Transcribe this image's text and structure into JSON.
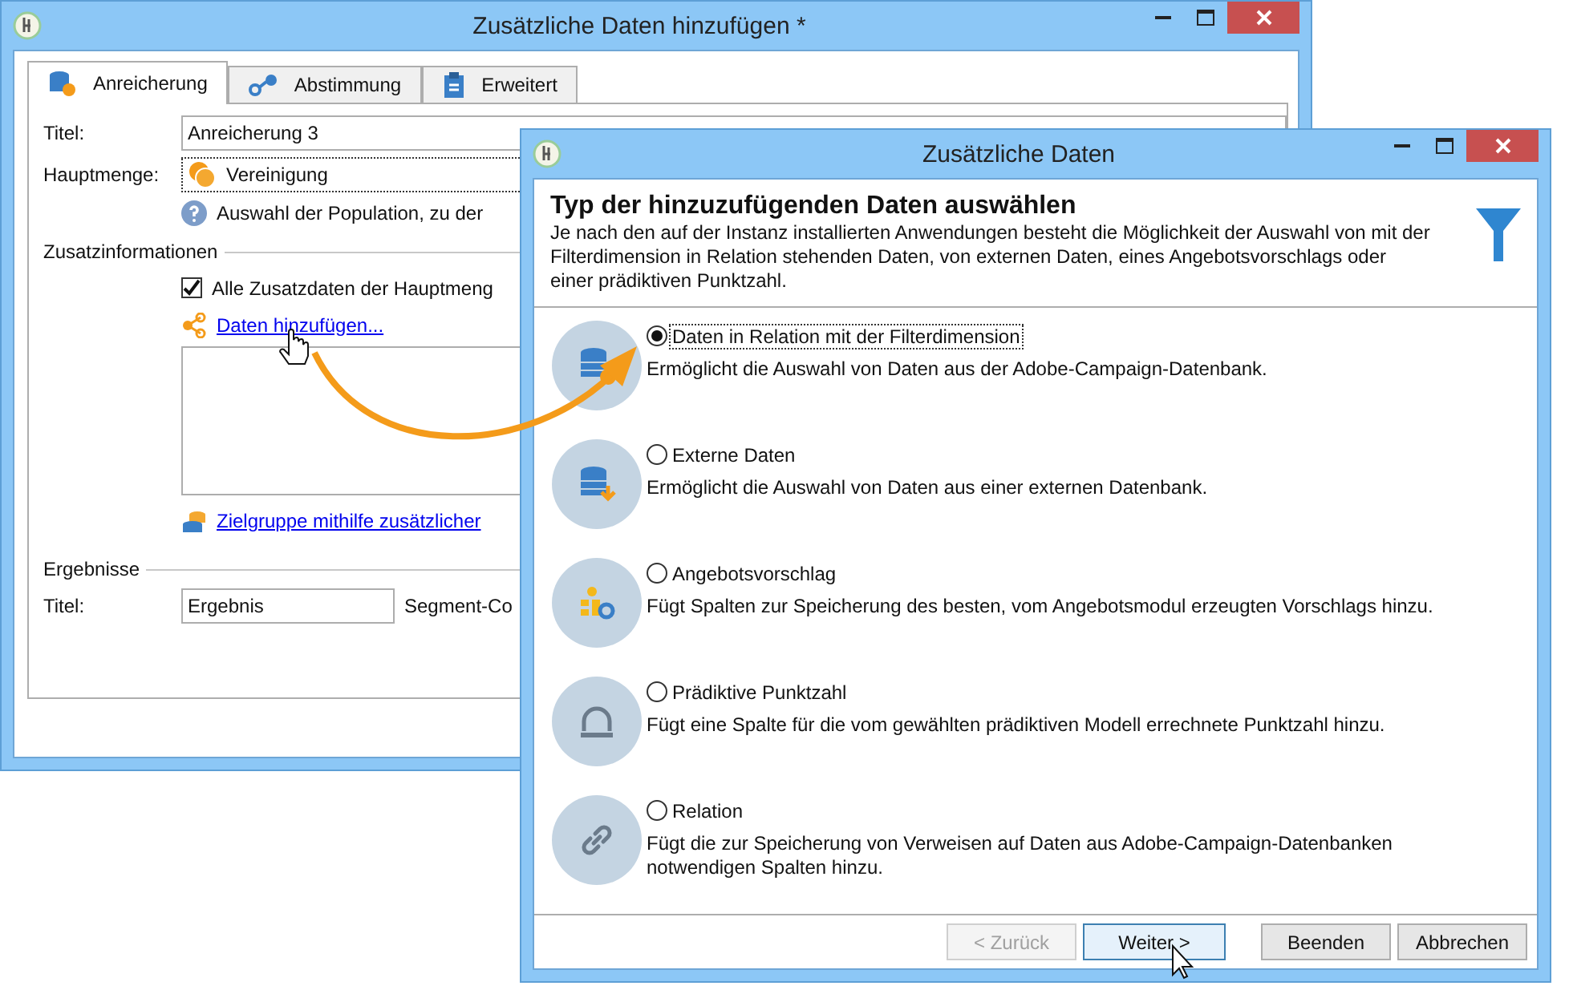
{
  "back_window": {
    "title": "Zusätzliche Daten hinzufügen *",
    "tabs": [
      {
        "label": "Anreicherung",
        "selected": true
      },
      {
        "label": "Abstimmung",
        "selected": false
      },
      {
        "label": "Erweitert",
        "selected": false
      }
    ],
    "title_label": "Titel:",
    "title_value": "Anreicherung 3",
    "main_set_label": "Hauptmenge:",
    "main_set_value": "Vereinigung",
    "help_text": "Auswahl der Population, zu der",
    "extra_section": "Zusatzinformationen",
    "all_extra_checkbox": {
      "label": "Alle Zusatzdaten der Hauptmeng",
      "checked": true
    },
    "add_data_link": "Daten hinzufügen...",
    "target_link": "Zielgruppe mithilfe zusätzlicher",
    "results_section": "Ergebnisse",
    "result_label": "Titel:",
    "result_value": "Ergebnis",
    "segment_label": "Segment-Co"
  },
  "front_window": {
    "title": "Zusätzliche Daten",
    "heading": "Typ der hinzuzufügenden Daten auswählen",
    "description": "Je nach den auf der Instanz installierten Anwendungen besteht die Möglichkeit der Auswahl von mit der Filterdimension in Relation stehenden Daten, von externen Daten, eines Angebotsvorschlags oder einer prädiktiven Punktzahl.",
    "options": [
      {
        "label": "Daten in Relation mit der Filterdimension",
        "description": "Ermöglicht die Auswahl von Daten aus der Adobe-Campaign-Datenbank.",
        "selected": true
      },
      {
        "label": "Externe Daten",
        "description": "Ermöglicht die Auswahl von Daten aus einer externen Datenbank.",
        "selected": false
      },
      {
        "label": "Angebotsvorschlag",
        "description": "Fügt Spalten zur Speicherung des besten, vom Angebotsmodul erzeugten Vorschlags hinzu.",
        "selected": false
      },
      {
        "label": "Prädiktive Punktzahl",
        "description": "Fügt eine Spalte für die vom gewählten prädiktiven Modell errechnete Punktzahl hinzu.",
        "selected": false
      },
      {
        "label": "Relation",
        "description": "Fügt die zur Speicherung von Verweisen auf Daten aus Adobe-Campaign-Datenbanken notwendigen Spalten hinzu.",
        "selected": false
      }
    ],
    "buttons": [
      {
        "label": "< Zurück",
        "disabled": true,
        "focused": false
      },
      {
        "label": "Weiter >",
        "disabled": false,
        "focused": true
      },
      {
        "label": "Beenden",
        "disabled": false,
        "focused": false
      },
      {
        "label": "Abbrechen",
        "disabled": false,
        "focused": false
      }
    ]
  }
}
